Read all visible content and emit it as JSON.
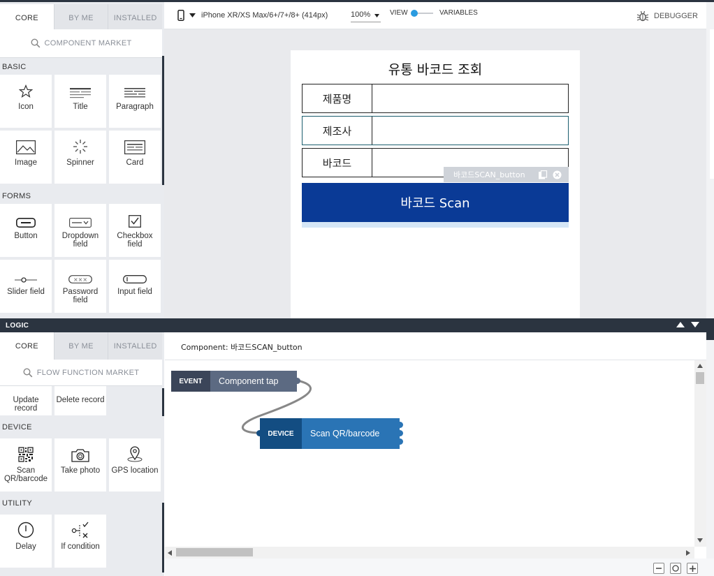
{
  "top_tabs": [
    "CORE",
    "BY ME",
    "INSTALLED"
  ],
  "component_market": "COMPONENT MARKET",
  "sections": {
    "basic": "BASIC",
    "forms": "FORMS"
  },
  "basic_items": [
    "Icon",
    "Title",
    "Paragraph",
    "Image",
    "Spinner",
    "Card"
  ],
  "form_items": [
    "Button",
    "Dropdown field",
    "Checkbox field",
    "Slider field",
    "Password field",
    "Input field"
  ],
  "toolbar": {
    "device": "iPhone XR/XS Max/6+/7+/8+ (414px)",
    "zoom": "100%",
    "view_label": "VIEW",
    "variables_label": "VARIABLES",
    "debugger_label": "DEBUGGER"
  },
  "phone": {
    "title": "유통 바코드 조회",
    "fields": [
      "제품명",
      "제조사",
      "바코드"
    ],
    "scan_button": "바코드 Scan",
    "selected_tag": "바코드SCAN_button"
  },
  "logic": {
    "bar_label": "LOGIC",
    "tabs": [
      "CORE",
      "BY ME",
      "INSTALLED"
    ],
    "flow_market": "FLOW FUNCTION MARKET",
    "record_items": [
      "Update record",
      "Delete record"
    ],
    "device_section": "DEVICE",
    "device_items": [
      "Scan QR/barcode",
      "Take photo",
      "GPS location"
    ],
    "utility_section": "UTILITY",
    "utility_items": [
      "Delay",
      "If condition"
    ],
    "component_header": "Component: 바코드SCAN_button",
    "event_node": {
      "tag": "EVENT",
      "name": "Component tap"
    },
    "device_node": {
      "tag": "DEVICE",
      "name": "Scan QR/barcode"
    }
  },
  "colors": {
    "scan_button": "#0a3a96",
    "dark_bar": "#2b3440",
    "device_node": "#2a74b5",
    "event_node": "#5c6a82",
    "toggle": "#2a9be0"
  }
}
